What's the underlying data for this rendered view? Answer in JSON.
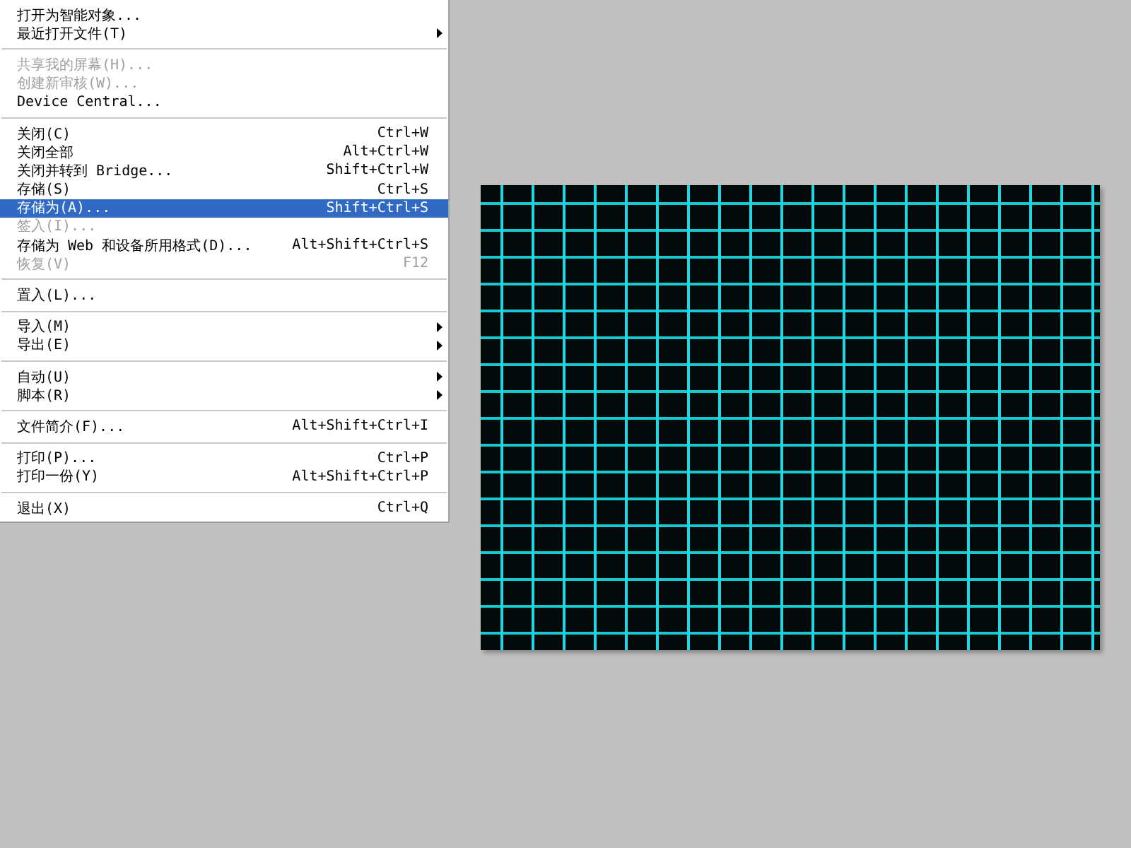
{
  "menu": {
    "items": [
      {
        "kind": "item",
        "label": "打开为智能对象...",
        "disabled": false,
        "selected": false,
        "submenu": false
      },
      {
        "kind": "item",
        "label": "最近打开文件(T)",
        "disabled": false,
        "selected": false,
        "submenu": true
      },
      {
        "kind": "separator"
      },
      {
        "kind": "item",
        "label": "共享我的屏幕(H)...",
        "disabled": true,
        "selected": false,
        "submenu": false
      },
      {
        "kind": "item",
        "label": "创建新审核(W)...",
        "disabled": true,
        "selected": false,
        "submenu": false
      },
      {
        "kind": "item",
        "label": "Device Central...",
        "disabled": false,
        "selected": false,
        "submenu": false
      },
      {
        "kind": "separator"
      },
      {
        "kind": "item",
        "label": "关闭(C)",
        "shortcut": "Ctrl+W",
        "disabled": false,
        "selected": false,
        "submenu": false
      },
      {
        "kind": "item",
        "label": "关闭全部",
        "shortcut": "Alt+Ctrl+W",
        "disabled": false,
        "selected": false,
        "submenu": false
      },
      {
        "kind": "item",
        "label": "关闭并转到 Bridge...",
        "shortcut": "Shift+Ctrl+W",
        "disabled": false,
        "selected": false,
        "submenu": false
      },
      {
        "kind": "item",
        "label": "存储(S)",
        "shortcut": "Ctrl+S",
        "disabled": false,
        "selected": false,
        "submenu": false
      },
      {
        "kind": "item",
        "label": "存储为(A)...",
        "shortcut": "Shift+Ctrl+S",
        "disabled": false,
        "selected": true,
        "submenu": false
      },
      {
        "kind": "item",
        "label": "签入(I)...",
        "disabled": true,
        "selected": false,
        "submenu": false
      },
      {
        "kind": "item",
        "label": "存储为 Web 和设备所用格式(D)...",
        "shortcut": "Alt+Shift+Ctrl+S",
        "disabled": false,
        "selected": false,
        "submenu": false
      },
      {
        "kind": "item",
        "label": "恢复(V)",
        "shortcut": "F12",
        "disabled": true,
        "selected": false,
        "submenu": false
      },
      {
        "kind": "separator"
      },
      {
        "kind": "item",
        "label": "置入(L)...",
        "disabled": false,
        "selected": false,
        "submenu": false
      },
      {
        "kind": "separator"
      },
      {
        "kind": "item",
        "label": "导入(M)",
        "disabled": false,
        "selected": false,
        "submenu": true
      },
      {
        "kind": "item",
        "label": "导出(E)",
        "disabled": false,
        "selected": false,
        "submenu": true
      },
      {
        "kind": "separator"
      },
      {
        "kind": "item",
        "label": "自动(U)",
        "disabled": false,
        "selected": false,
        "submenu": true
      },
      {
        "kind": "item",
        "label": "脚本(R)",
        "disabled": false,
        "selected": false,
        "submenu": true
      },
      {
        "kind": "separator"
      },
      {
        "kind": "item",
        "label": "文件简介(F)...",
        "shortcut": "Alt+Shift+Ctrl+I",
        "disabled": false,
        "selected": false,
        "submenu": false
      },
      {
        "kind": "separator"
      },
      {
        "kind": "item",
        "label": "打印(P)...",
        "shortcut": "Ctrl+P",
        "disabled": false,
        "selected": false,
        "submenu": false
      },
      {
        "kind": "item",
        "label": "打印一份(Y)",
        "shortcut": "Alt+Shift+Ctrl+P",
        "disabled": false,
        "selected": false,
        "submenu": false
      },
      {
        "kind": "separator"
      },
      {
        "kind": "item",
        "label": "退出(X)",
        "shortcut": "Ctrl+Q",
        "disabled": false,
        "selected": false,
        "submenu": false
      }
    ]
  }
}
